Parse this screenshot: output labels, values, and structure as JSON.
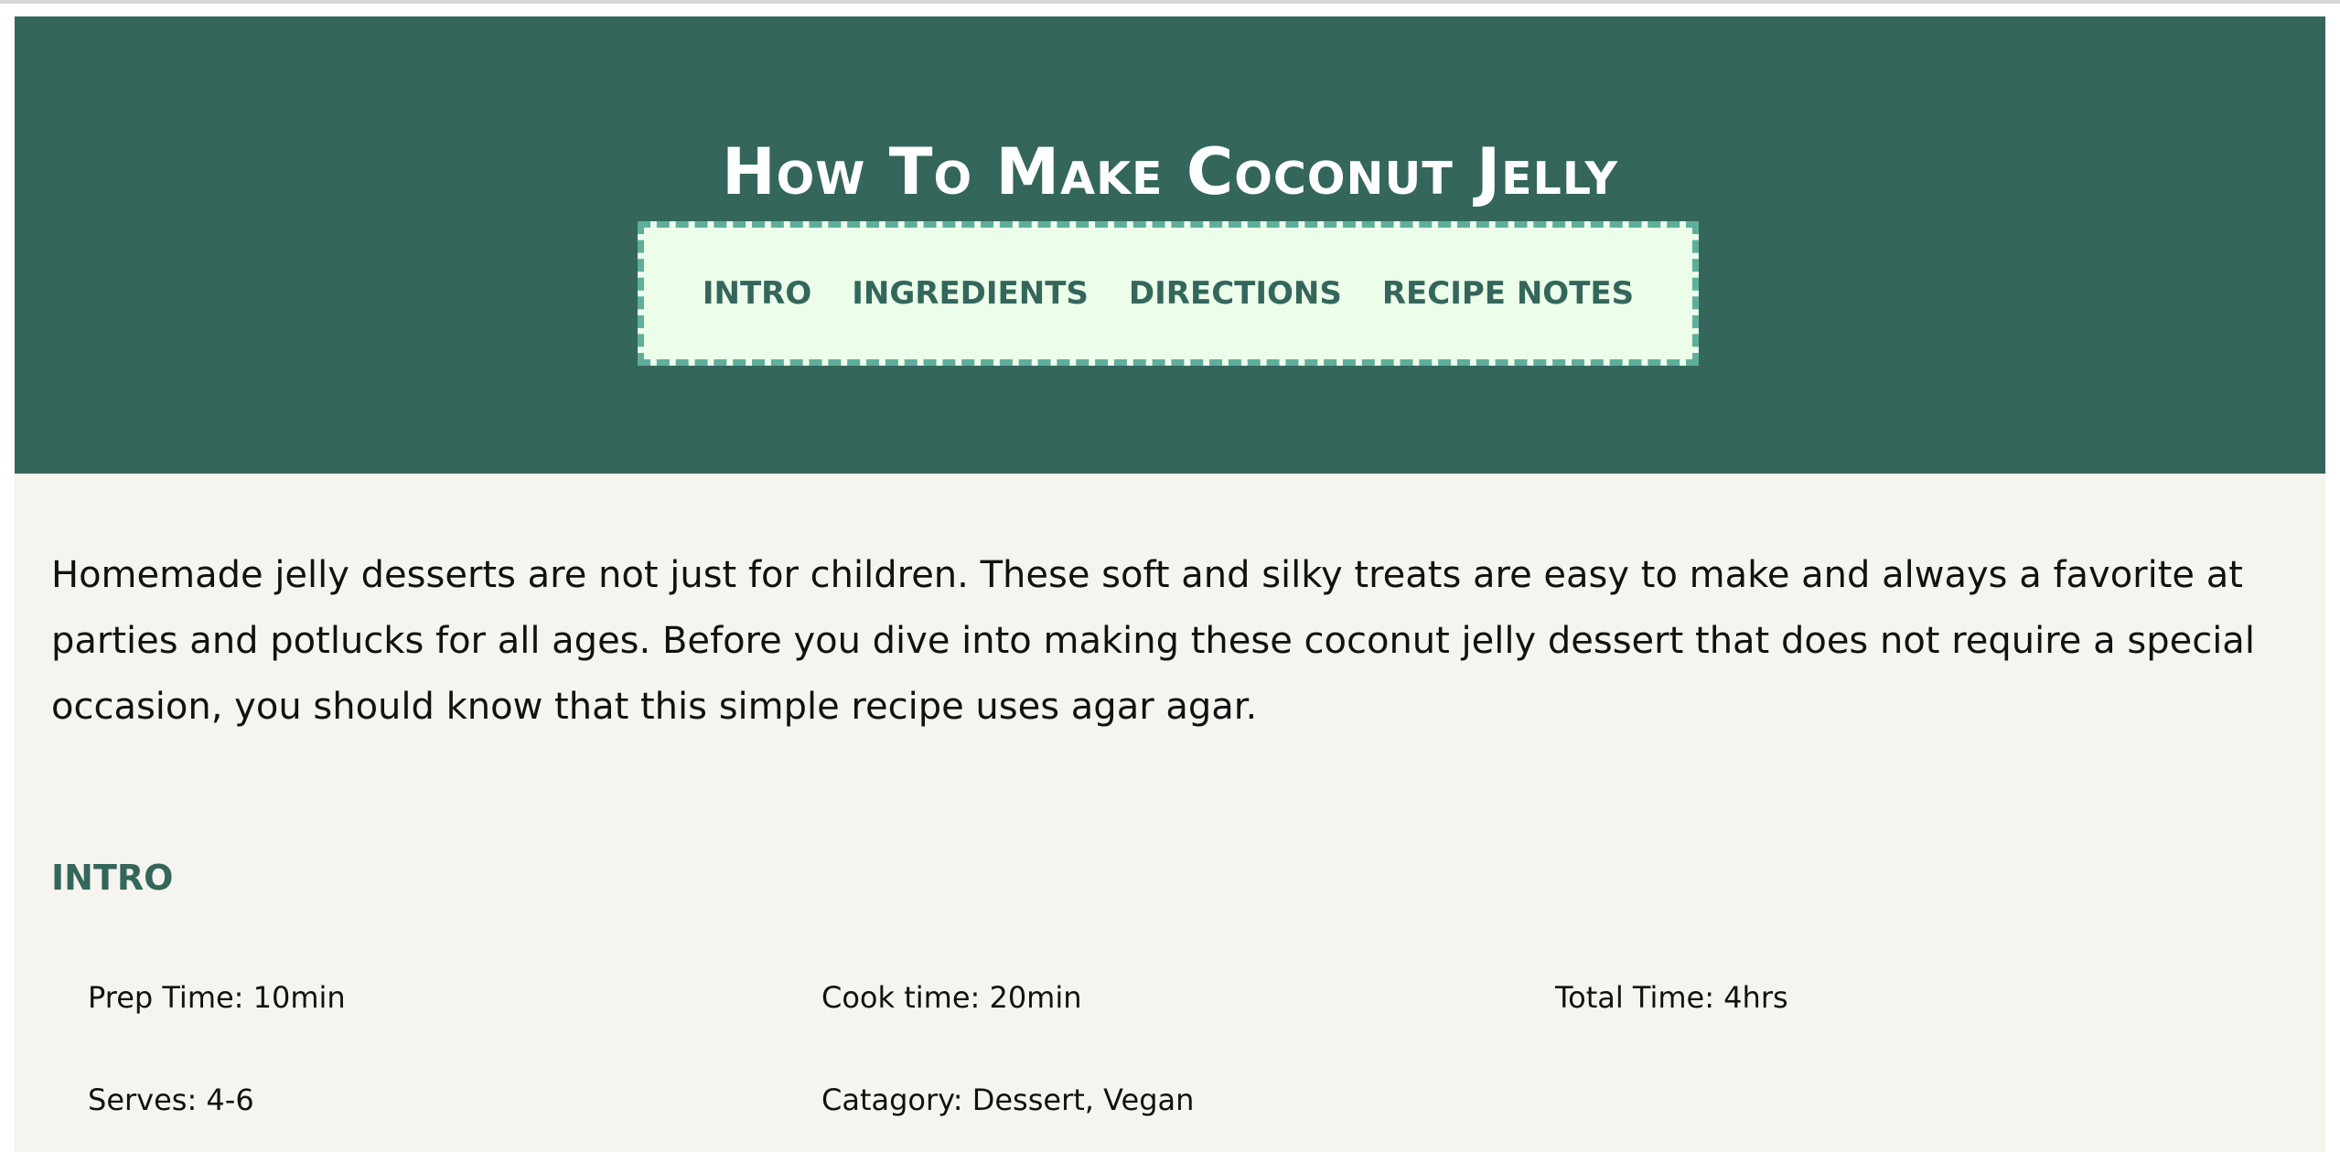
{
  "header": {
    "title": "How To Make Coconut Jelly"
  },
  "nav": {
    "items": [
      "INTRO",
      "INGREDIENTS",
      "DIRECTIONS",
      "RECIPE NOTES"
    ]
  },
  "intro_text": "Homemade jelly desserts are not just for children. These soft and silky treats are easy to make and always a favorite at parties and potlucks for all ages. Before you dive into making these coconut jelly dessert that does not require a special occasion, you should know that this simple recipe uses agar agar.",
  "sections": {
    "intro_heading": "INTRO"
  },
  "details": {
    "prep_time": "Prep Time: 10min",
    "cook_time": "Cook time: 20min",
    "total_time": "Total Time: 4hrs",
    "serves": "Serves: 4-6",
    "category": "Catagory: Dessert, Vegan"
  },
  "colors": {
    "header_bg": "#34665b",
    "nav_bg": "#ecfde9",
    "nav_border": "#5fae9c",
    "page_bg": "#f5f4ee"
  }
}
